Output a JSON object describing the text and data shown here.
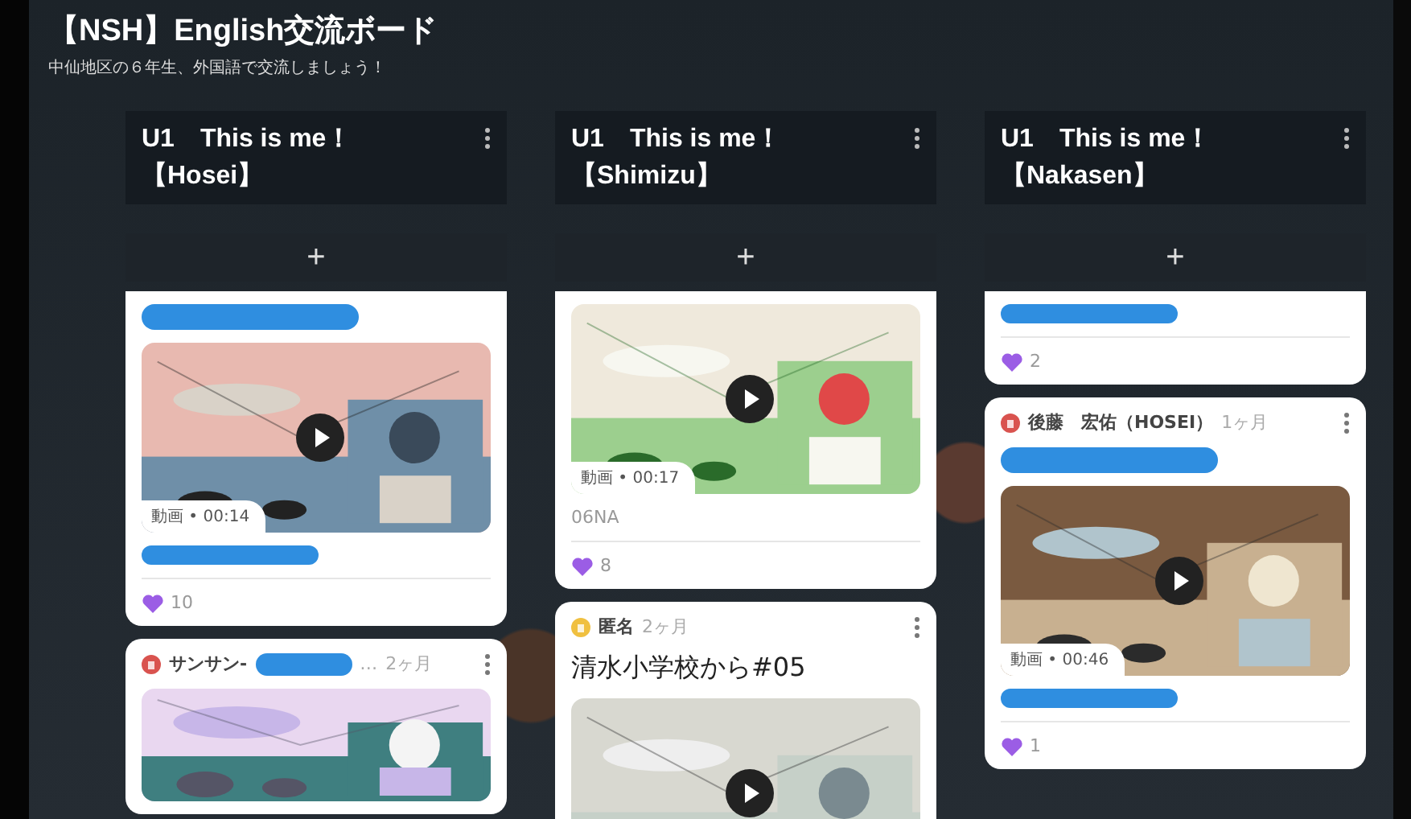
{
  "board": {
    "title": "【NSH】English交流ボード",
    "subtitle": "中仙地区の６年生、外国語で交流しましょう！"
  },
  "columns": [
    {
      "title": [
        "U1　This is me！",
        "【Hosei】"
      ],
      "add_label": "+",
      "posts": [
        {
          "title_redacted": true,
          "media": {
            "kind": "video",
            "duration": "動画 • 00:14"
          },
          "caption_redacted": true,
          "likes": "10"
        },
        {
          "author": "サンサン-",
          "author_redacted": true,
          "author_tail": "…",
          "time": "2ヶ月"
        }
      ]
    },
    {
      "title": [
        "U1　This is me！",
        "【Shimizu】"
      ],
      "add_label": "+",
      "posts": [
        {
          "media": {
            "kind": "video",
            "duration": "動画 • 00:17"
          },
          "caption": "06NA",
          "likes": "8"
        },
        {
          "author": "匿名",
          "time": "2ヶ月",
          "title": "清水小学校から#05",
          "media": {
            "kind": "video"
          }
        }
      ]
    },
    {
      "title": [
        "U1　This is me！",
        "【Nakasen】"
      ],
      "add_label": "+",
      "posts": [
        {
          "caption_redacted": true,
          "likes": "2"
        },
        {
          "author": "後藤　宏佑（HOSEI）",
          "time": "1ヶ月",
          "title_redacted": true,
          "media": {
            "kind": "video",
            "duration": "動画 • 00:46"
          },
          "caption_redacted": true,
          "likes": "1"
        }
      ]
    }
  ]
}
